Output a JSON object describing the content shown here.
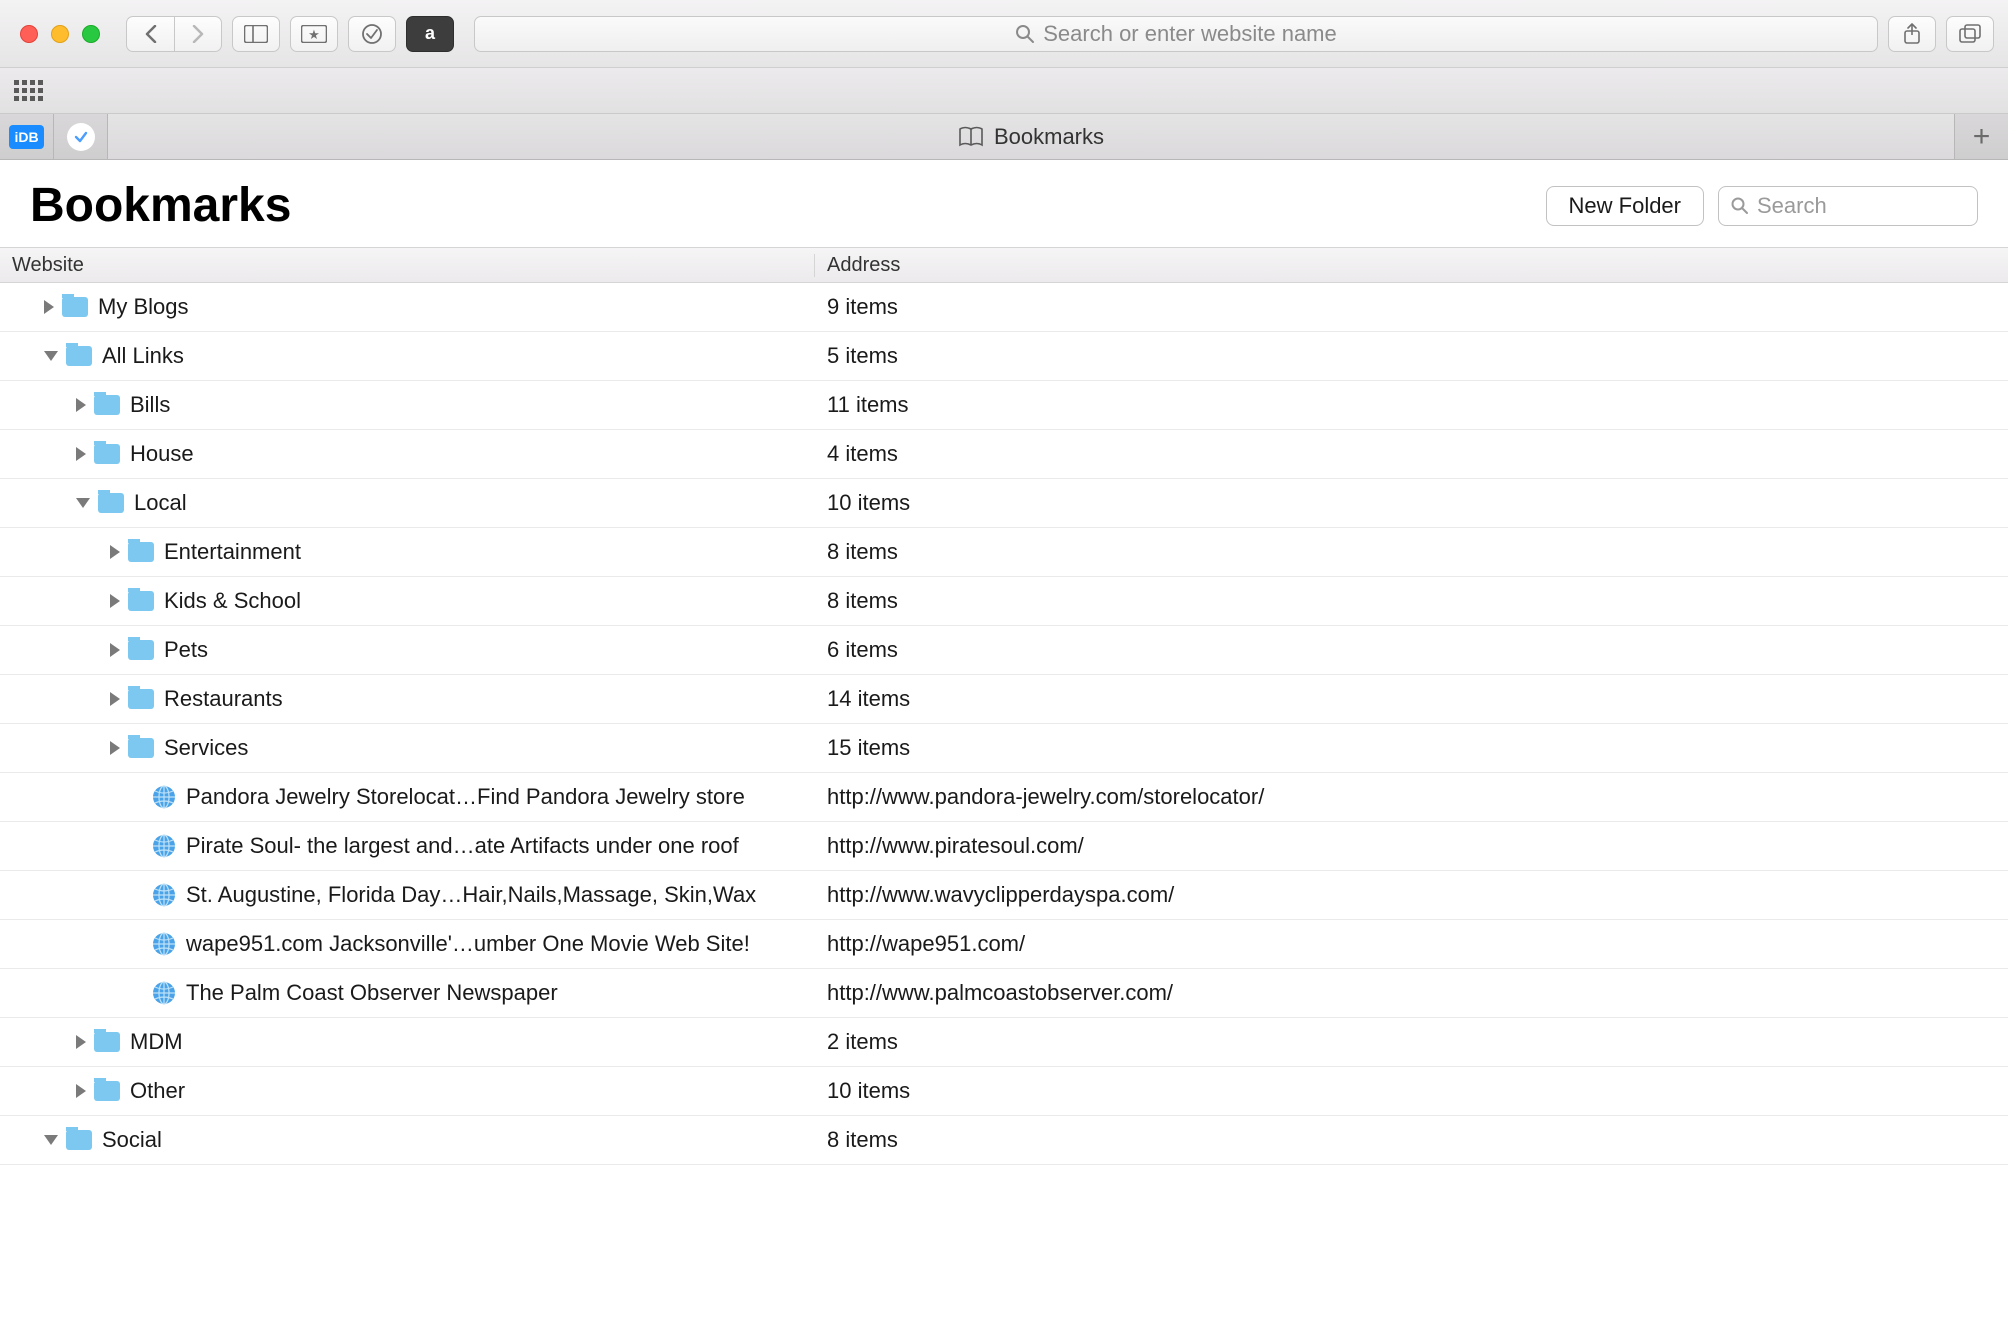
{
  "toolbar": {
    "url_placeholder": "Search or enter website name",
    "amazon_label": "a"
  },
  "tabbar": {
    "pinned1": "iDB",
    "active_tab": "Bookmarks"
  },
  "page": {
    "title": "Bookmarks",
    "new_folder": "New Folder",
    "search_placeholder": "Search"
  },
  "columns": {
    "website": "Website",
    "address": "Address"
  },
  "rows": [
    {
      "indent": 0,
      "type": "folder",
      "expanded": false,
      "name": "My Blogs",
      "addr": "9 items"
    },
    {
      "indent": 0,
      "type": "folder",
      "expanded": true,
      "name": "All Links",
      "addr": "5 items"
    },
    {
      "indent": 1,
      "type": "folder",
      "expanded": false,
      "name": "Bills",
      "addr": "11 items"
    },
    {
      "indent": 1,
      "type": "folder",
      "expanded": false,
      "name": "House",
      "addr": "4 items"
    },
    {
      "indent": 1,
      "type": "folder",
      "expanded": true,
      "name": "Local",
      "addr": "10 items"
    },
    {
      "indent": 2,
      "type": "folder",
      "expanded": false,
      "name": "Entertainment",
      "addr": "8 items"
    },
    {
      "indent": 2,
      "type": "folder",
      "expanded": false,
      "name": "Kids & School",
      "addr": "8 items"
    },
    {
      "indent": 2,
      "type": "folder",
      "expanded": false,
      "name": "Pets",
      "addr": "6 items"
    },
    {
      "indent": 2,
      "type": "folder",
      "expanded": false,
      "name": "Restaurants",
      "addr": "14 items"
    },
    {
      "indent": 2,
      "type": "folder",
      "expanded": false,
      "name": "Services",
      "addr": "15 items"
    },
    {
      "indent": 3,
      "type": "link",
      "name": "Pandora Jewelry Storelocat…Find Pandora Jewelry store",
      "addr": "http://www.pandora-jewelry.com/storelocator/"
    },
    {
      "indent": 3,
      "type": "link",
      "name": "Pirate Soul- the largest and…ate Artifacts under one roof",
      "addr": "http://www.piratesoul.com/"
    },
    {
      "indent": 3,
      "type": "link",
      "name": "St. Augustine, Florida Day…Hair,Nails,Massage, Skin,Wax",
      "addr": "http://www.wavyclipperdayspa.com/"
    },
    {
      "indent": 3,
      "type": "link",
      "name": "wape951.com Jacksonville'…umber One Movie Web Site!",
      "addr": "http://wape951.com/"
    },
    {
      "indent": 3,
      "type": "link",
      "name": "The Palm Coast Observer Newspaper",
      "addr": "http://www.palmcoastobserver.com/"
    },
    {
      "indent": 1,
      "type": "folder",
      "expanded": false,
      "name": "MDM",
      "addr": "2 items"
    },
    {
      "indent": 1,
      "type": "folder",
      "expanded": false,
      "name": "Other",
      "addr": "10 items"
    },
    {
      "indent": 0,
      "type": "folder",
      "expanded": true,
      "name": "Social",
      "addr": "8 items"
    }
  ]
}
